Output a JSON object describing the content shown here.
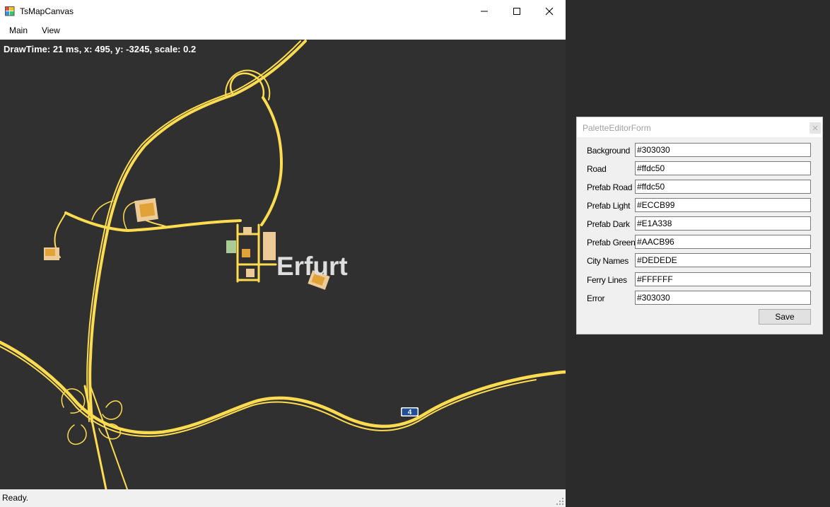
{
  "window": {
    "title": "TsMapCanvas",
    "menu": [
      "Main",
      "View"
    ],
    "status": "Ready."
  },
  "map": {
    "draw_info": "DrawTime: 21 ms, x: 495, y: -3245, scale: 0.2",
    "city_name": "Erfurt",
    "route_shield": "4",
    "colors": {
      "background": "#303030",
      "road": "#ffdc50",
      "prefab_light": "#ECCB99",
      "prefab_dark": "#E1A338",
      "prefab_green": "#AACB96",
      "city_names": "#DEDEDE"
    }
  },
  "palette": {
    "title": "PaletteEditorForm",
    "fields": [
      {
        "label": "Background",
        "value": "#303030"
      },
      {
        "label": "Road",
        "value": "#ffdc50"
      },
      {
        "label": "Prefab Road",
        "value": "#ffdc50"
      },
      {
        "label": "Prefab Light",
        "value": "#ECCB99"
      },
      {
        "label": "Prefab Dark",
        "value": "#E1A338"
      },
      {
        "label": "Prefab Green",
        "value": "#AACB96"
      },
      {
        "label": "City Names",
        "value": "#DEDEDE"
      },
      {
        "label": "Ferry Lines",
        "value": "#FFFFFF"
      },
      {
        "label": "Error",
        "value": "#303030"
      }
    ],
    "save_label": "Save"
  }
}
